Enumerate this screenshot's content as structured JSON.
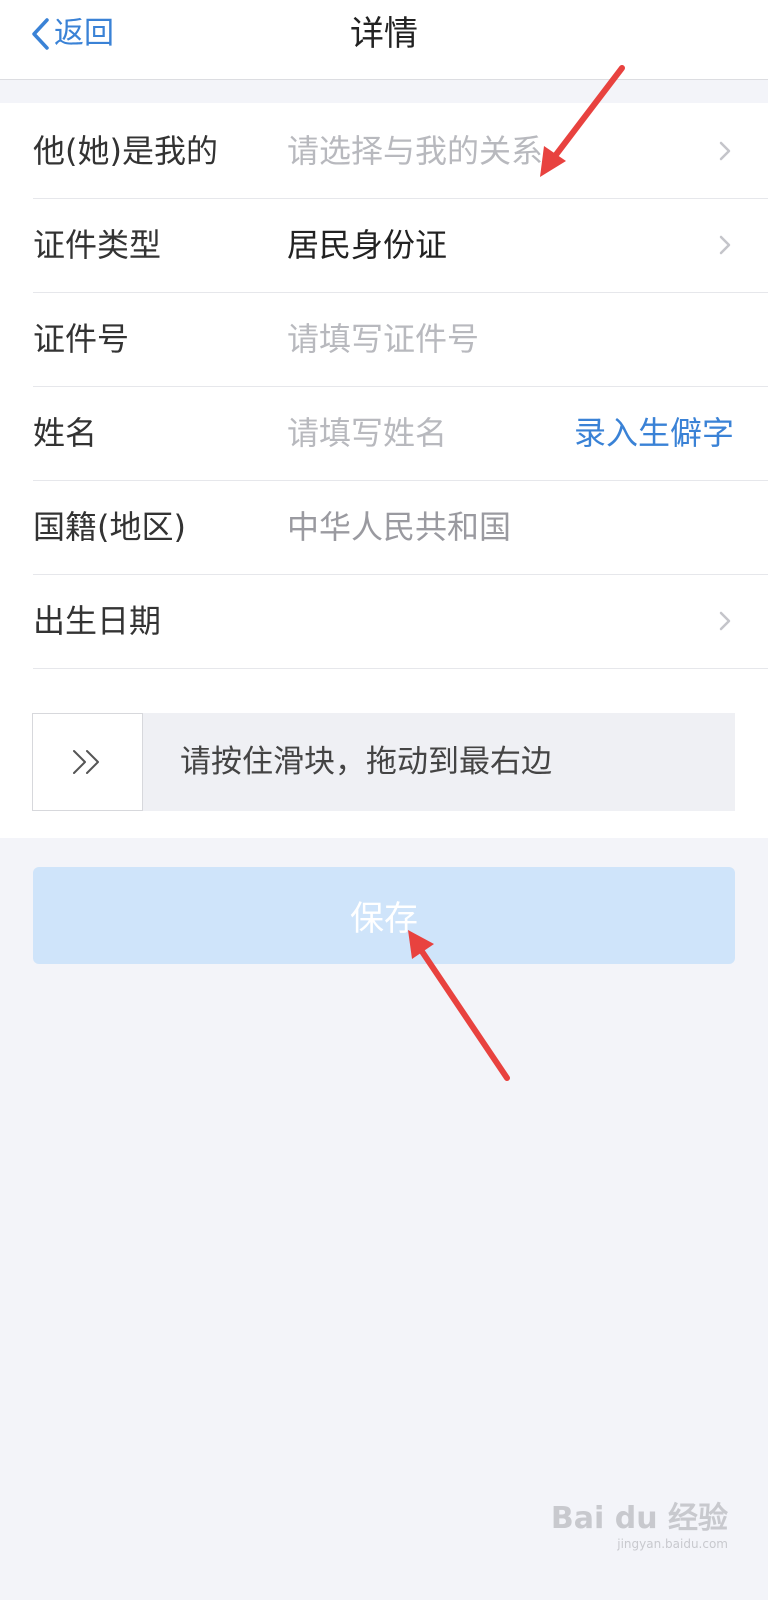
{
  "nav": {
    "back_label": "返回",
    "title": "详情"
  },
  "form": {
    "rows": [
      {
        "label": "他(她)是我的",
        "value": "请选择与我的关系",
        "state": "placeholder",
        "chevron": true
      },
      {
        "label": "证件类型",
        "value": "居民身份证",
        "state": "filled",
        "chevron": true
      },
      {
        "label": "证件号",
        "value": "请填写证件号",
        "state": "placeholder",
        "chevron": false
      },
      {
        "label": "姓名",
        "value": "请填写姓名",
        "state": "placeholder",
        "chevron": false,
        "action": "录入生僻字"
      },
      {
        "label": "国籍(地区)",
        "value": "中华人民共和国",
        "state": "muted",
        "chevron": false
      },
      {
        "label": "出生日期",
        "value": "",
        "state": "placeholder",
        "chevron": true
      }
    ]
  },
  "slider": {
    "handle_icon": "double-chevron-right-icon",
    "text": "请按住滑块，拖动到最右边"
  },
  "save_button": {
    "label": "保存"
  },
  "watermark": {
    "logo_text": "Bai du 经验",
    "sub_text": "jingyan.baidu.com"
  },
  "colors": {
    "accent": "#3a82d6",
    "save_button_bg": "#cfe4fa",
    "page_bg": "#f3f4f9",
    "annotation_arrow": "#e8423f"
  }
}
